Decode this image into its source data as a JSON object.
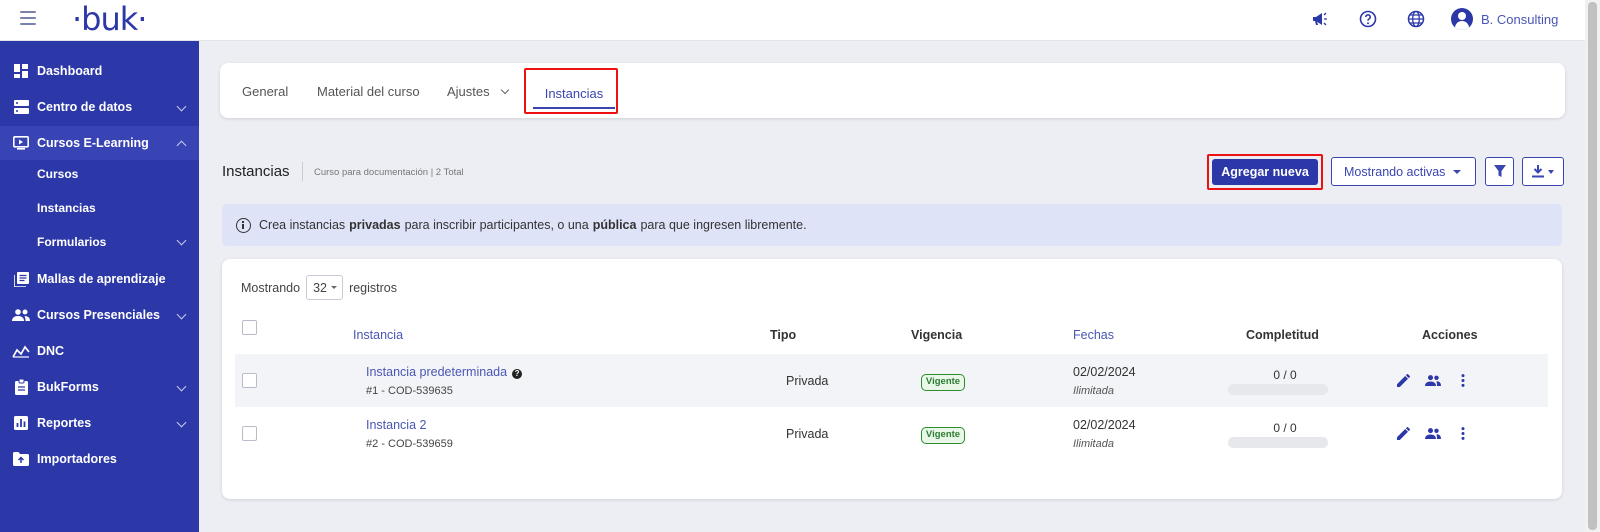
{
  "brand": {
    "logo": "·buk·",
    "user_name": "B. Consulting"
  },
  "topbar_icons": [
    "megaphone-icon",
    "help-circle-icon",
    "globe-icon",
    "user-avatar"
  ],
  "colors": {
    "primary": "#2c37a8",
    "highlight": "#e11111",
    "badge_green": "#2e8b2e",
    "info_bg": "#dfe3f8"
  },
  "sidebar": {
    "items": [
      {
        "label": "Dashboard",
        "icon": "dashboard-icon",
        "expandable": false
      },
      {
        "label": "Centro de datos",
        "icon": "database-icon",
        "expandable": true
      },
      {
        "label": "Cursos E-Learning",
        "icon": "elearning-icon",
        "expandable": true,
        "expanded": true
      },
      {
        "label": "Mallas de aprendizaje",
        "icon": "book-list-icon",
        "expandable": false
      },
      {
        "label": "Cursos Presenciales",
        "icon": "people-icon",
        "expandable": true
      },
      {
        "label": "DNC",
        "icon": "trend-icon",
        "expandable": false
      },
      {
        "label": "BukForms",
        "icon": "clipboard-icon",
        "expandable": true
      },
      {
        "label": "Reportes",
        "icon": "report-icon",
        "expandable": true
      },
      {
        "label": "Importadores",
        "icon": "import-folder-icon",
        "expandable": false
      }
    ],
    "subitems": [
      {
        "label": "Cursos"
      },
      {
        "label": "Instancias"
      },
      {
        "label": "Formularios",
        "expandable": true
      }
    ]
  },
  "tabs": {
    "general": "General",
    "material": "Material del curso",
    "ajustes": "Ajustes",
    "instancias": "Instancias"
  },
  "section": {
    "title": "Instancias",
    "subtitle": "Curso para documentación | 2 Total",
    "add_label": "Agregar nueva",
    "show_label": "Mostrando activas"
  },
  "info": {
    "part1": "Crea instancias",
    "bold1": "privadas",
    "part2": "para inscribir participantes, o una",
    "bold2": "pública",
    "part3": "para que ingresen libremente."
  },
  "table": {
    "showing_prefix": "Mostrando",
    "per_page": "32",
    "showing_suffix": "registros",
    "headers": {
      "instancia": "Instancia",
      "tipo": "Tipo",
      "vigencia": "Vigencia",
      "fechas": "Fechas",
      "completitud": "Completitud",
      "acciones": "Acciones"
    },
    "rows": [
      {
        "name": "Instancia predeterminada",
        "help": true,
        "code": "#1 - COD-539635",
        "tipo": "Privada",
        "vigencia": "Vigente",
        "fecha": "02/02/2024",
        "fecha_sub": "Ilimitada",
        "completitud": "0 / 0",
        "progress": 0
      },
      {
        "name": "Instancia 2",
        "help": false,
        "code": "#2 - COD-539659",
        "tipo": "Privada",
        "vigencia": "Vigente",
        "fecha": "02/02/2024",
        "fecha_sub": "Ilimitada",
        "completitud": "0 / 0",
        "progress": 0
      }
    ]
  }
}
